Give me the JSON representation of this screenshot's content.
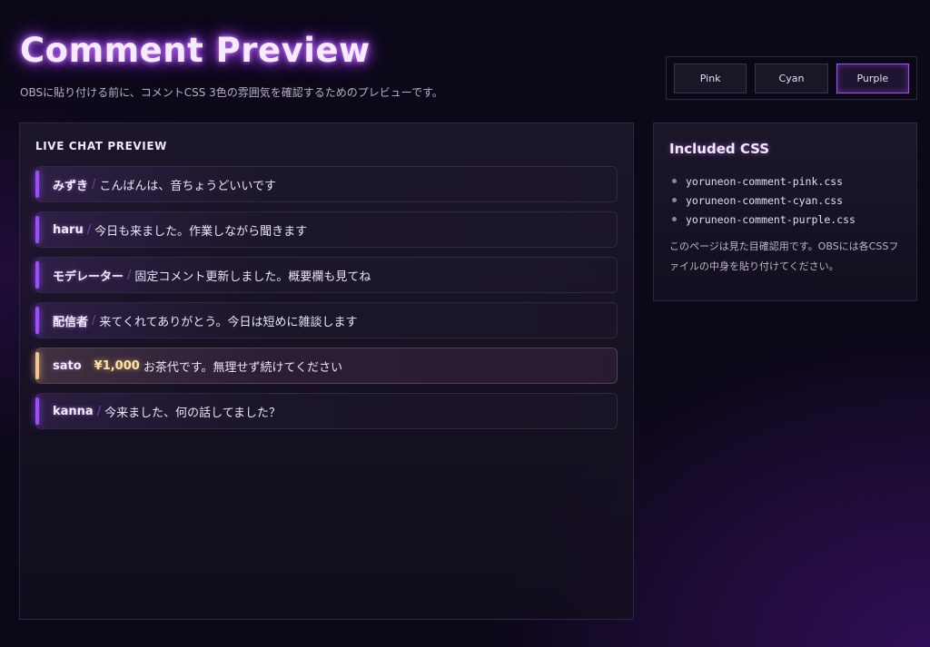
{
  "header": {
    "title": "Comment Preview",
    "subtitle": "OBSに貼り付ける前に、コメントCSS 3色の雰囲気を確認するためのプレビューです。"
  },
  "theme_switch": {
    "buttons": [
      "Pink",
      "Cyan",
      "Purple"
    ],
    "active": "Purple"
  },
  "chat_panel": {
    "heading": "LIVE CHAT PREVIEW",
    "messages": [
      {
        "author": "みずき",
        "separator": "/",
        "text": "こんばんは、音ちょうどいいです"
      },
      {
        "author": "haru",
        "separator": "/",
        "text": "今日も来ました。作業しながら聞きます"
      },
      {
        "author": "モデレーター",
        "separator": "/",
        "text": "固定コメント更新しました。概要欄も見てね"
      },
      {
        "author": "配信者",
        "separator": "/",
        "text": "来てくれてありがとう。今日は短めに雑談します"
      },
      {
        "author": "sato",
        "amount": "¥1,000",
        "text": "お茶代です。無理せず続けてください"
      },
      {
        "author": "kanna",
        "separator": "/",
        "text": "今来ました、何の話してました？"
      }
    ]
  },
  "css_panel": {
    "title": "Included CSS",
    "files": [
      "yoruneon-comment-pink.css",
      "yoruneon-comment-cyan.css",
      "yoruneon-comment-purple.css"
    ],
    "note": "このページは見た目確認用です。OBSには各CSSファイルの中身を貼り付けてください。"
  },
  "colors": {
    "accent": "#a64dff",
    "superchat_accent": "#f2c58a",
    "background": "#0c0818"
  }
}
